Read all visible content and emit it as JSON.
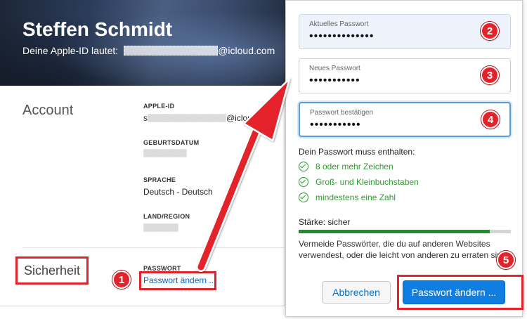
{
  "profile": {
    "name": "Steffen Schmidt",
    "appleid_prefix": "Deine Apple-ID lautet:",
    "appleid_suffix": "@icloud.com"
  },
  "account": {
    "title": "Account",
    "appleid_label": "APPLE-ID",
    "appleid_prefix": "s",
    "appleid_suffix": "@icloud....",
    "birthdate_label": "GEBURTSDATUM",
    "language_label": "SPRACHE",
    "language_value": "Deutsch - Deutsch",
    "region_label": "LAND/REGION"
  },
  "security": {
    "title": "Sicherheit",
    "password_label": "PASSWORT",
    "change_link": "Passwort ändern ..."
  },
  "dialog": {
    "current_label": "Aktuelles Passwort",
    "current_value": "••••••••••••••",
    "new_label": "Neues Passwort",
    "new_value": "•••••••••••",
    "confirm_label": "Passwort bestätigen",
    "confirm_value": "•••••••••••",
    "rules_title": "Dein Passwort muss enthalten:",
    "rules": [
      "8 oder mehr Zeichen",
      "Groß- und Kleinbuchstaben",
      "mindestens eine Zahl"
    ],
    "strength_label": "Stärke: sicher",
    "strength_fraction": 0.9,
    "advice": "Vermeide Passwörter, die du auf anderen Websites verwendest, oder die leicht von anderen zu erraten sind.",
    "cancel_label": "Abbrechen",
    "confirm_button_label": "Passwort ändern ..."
  },
  "badges": [
    "1",
    "2",
    "3",
    "4",
    "5"
  ],
  "colors": {
    "annotation_red": "#e3222a",
    "link_blue": "#0066cc",
    "primary_button": "#0f7ee0",
    "success_green": "#2d9c2d"
  }
}
